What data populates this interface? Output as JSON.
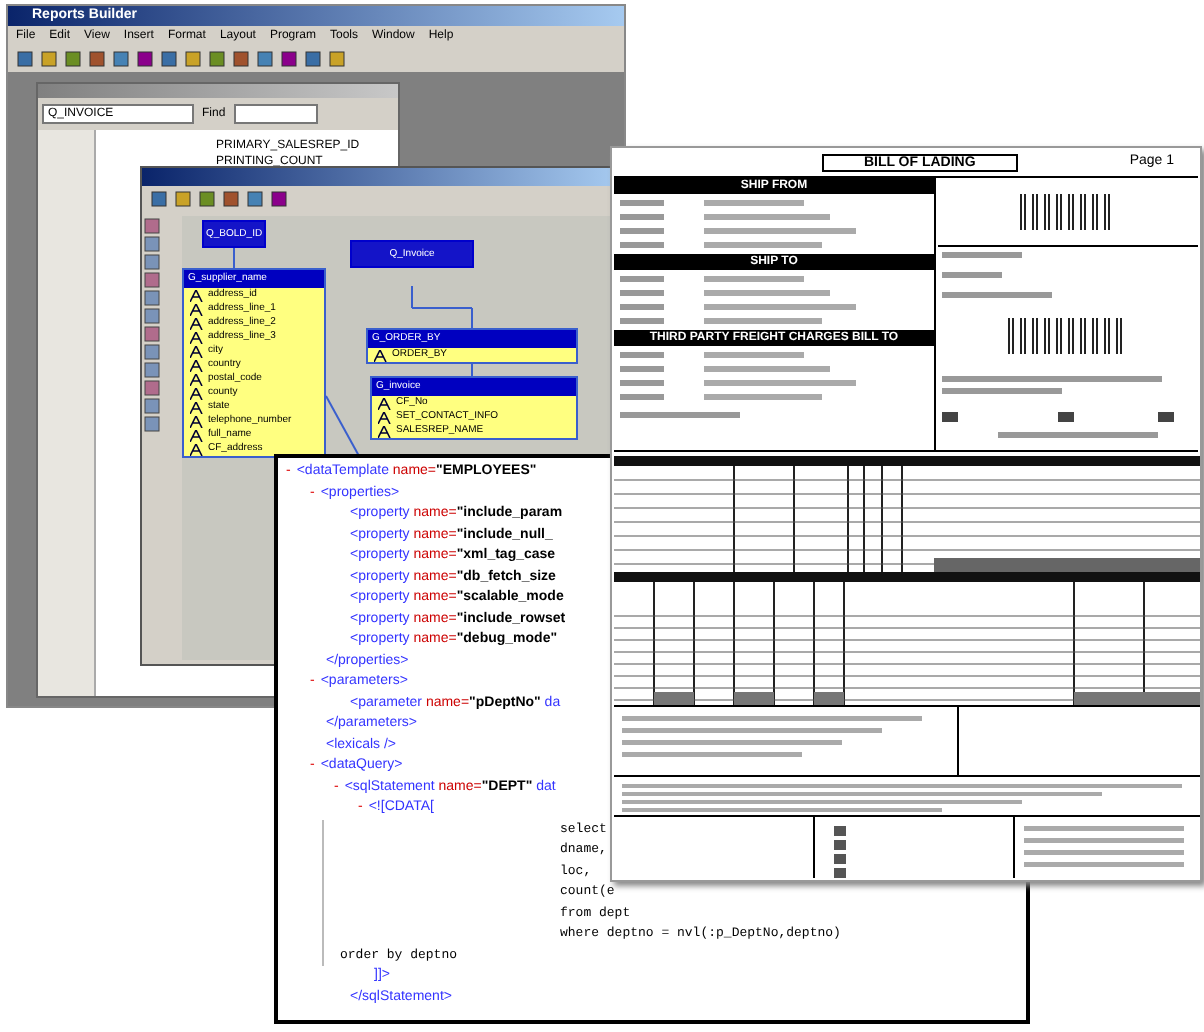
{
  "report_builder": {
    "title": "Reports Builder",
    "menu": [
      "File",
      "Edit",
      "View",
      "Insert",
      "Format",
      "Layout",
      "Program",
      "Tools",
      "Window",
      "Help"
    ],
    "navigator": {
      "query": "Q_INVOICE",
      "find_label": "Find",
      "items": [
        "PRIMARY_SALESREP_ID",
        "PRINTING_COUNT"
      ]
    }
  },
  "data_model": {
    "nodes": [
      {
        "kind": "query",
        "title": "Q_BOLD_ID"
      },
      {
        "kind": "query",
        "title": "Q_Invoice"
      },
      {
        "kind": "group",
        "title": "G_supplier_name",
        "items": [
          "address_id",
          "address_line_1",
          "address_line_2",
          "address_line_3",
          "city",
          "country",
          "postal_code",
          "county",
          "state",
          "telephone_number",
          "full_name",
          "CF_address"
        ]
      },
      {
        "kind": "group",
        "title": "G_ORDER_BY",
        "items": [
          "ORDER_BY"
        ]
      },
      {
        "kind": "group",
        "title": "G_invoice",
        "items": [
          "CF_No",
          "SET_CONTACT_INFO",
          "SALESREP_NAME"
        ]
      }
    ]
  },
  "xml": {
    "nodes": [
      {
        "kind": "tag",
        "toggle": "-",
        "expanded": true,
        "text": "<dataTemplate name=\"EMPLOYEES\"",
        "children": [
          {
            "kind": "tag",
            "toggle": "-",
            "expanded": true,
            "text": "<properties>",
            "children": [
              {
                "kind": "tag",
                "text": "<property name=\"include_param"
              },
              {
                "kind": "tag",
                "text": "<property name=\"include_null_"
              },
              {
                "kind": "tag",
                "text": "<property name=\"xml_tag_case"
              },
              {
                "kind": "tag",
                "text": "<property name=\"db_fetch_size"
              },
              {
                "kind": "tag",
                "text": "<property name=\"scalable_mode"
              },
              {
                "kind": "tag",
                "text": "<property name=\"include_rowset"
              },
              {
                "kind": "tag",
                "text": "<property name=\"debug_mode\""
              }
            ]
          },
          {
            "kind": "tag",
            "text": "</properties>"
          },
          {
            "kind": "tag",
            "toggle": "-",
            "expanded": true,
            "text": "<parameters>",
            "children": [
              {
                "kind": "tag",
                "text": "<parameter name=\"pDeptNo\" da"
              }
            ]
          },
          {
            "kind": "tag",
            "text": "</parameters>"
          },
          {
            "kind": "tag",
            "text": "<lexicals />"
          },
          {
            "kind": "tag",
            "toggle": "-",
            "expanded": true,
            "text": "<dataQuery>",
            "children": [
              {
                "kind": "tag",
                "toggle": "-",
                "expanded": true,
                "text": "<sqlStatement name=\"DEPT\" dat",
                "children": [
                  {
                    "kind": "tag",
                    "toggle": "-",
                    "expanded": true,
                    "text": "<![CDATA[",
                    "children": [
                      {
                        "kind": "sql-select",
                        "text": "select"
                      },
                      {
                        "kind": "sql-select",
                        "text": "dname,"
                      },
                      {
                        "kind": "sql-select",
                        "text": "loc,"
                      },
                      {
                        "kind": "sql-select",
                        "text": "count(e"
                      },
                      {
                        "kind": "sql-select",
                        "text": "from dept"
                      },
                      {
                        "kind": "sql-select",
                        "text": "where deptno = nvl(:p_DeptNo,deptno)"
                      },
                      {
                        "kind": "sql",
                        "text": "order by deptno"
                      }
                    ]
                  },
                  {
                    "kind": "tag",
                    "text": "]]>"
                  }
                ]
              },
              {
                "kind": "tag",
                "text": "</sqlStatement>"
              }
            ]
          }
        ]
      }
    ]
  },
  "bill": {
    "title": "BILL OF LADING",
    "page": "Page 1",
    "sections": [
      "SHIP FROM",
      "SHIP TO",
      "THIRD PARTY FREIGHT CHARGES BILL TO"
    ]
  }
}
